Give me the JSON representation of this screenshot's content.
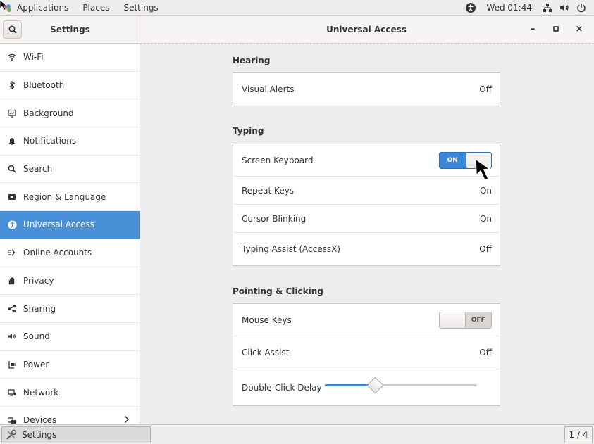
{
  "top_panel": {
    "menus": [
      "Applications",
      "Places",
      "Settings"
    ],
    "clock": "Wed 01:44",
    "icons": [
      "accessibility-icon",
      "network-icon",
      "volume-icon",
      "power-icon"
    ]
  },
  "window": {
    "sidebar_title": "Settings",
    "title": "Universal Access",
    "controls": {
      "minimize": "–",
      "maximize": "▫",
      "close": "×"
    }
  },
  "sidebar": {
    "items": [
      {
        "label": "Wi-Fi",
        "icon": "wifi-icon"
      },
      {
        "label": "Bluetooth",
        "icon": "bluetooth-icon"
      },
      {
        "label": "Background",
        "icon": "background-icon"
      },
      {
        "label": "Notifications",
        "icon": "bell-icon"
      },
      {
        "label": "Search",
        "icon": "search-icon"
      },
      {
        "label": "Region & Language",
        "icon": "region-icon"
      },
      {
        "label": "Universal Access",
        "icon": "accessibility-icon",
        "active": true
      },
      {
        "label": "Online Accounts",
        "icon": "online-accounts-icon"
      },
      {
        "label": "Privacy",
        "icon": "hand-icon"
      },
      {
        "label": "Sharing",
        "icon": "share-icon"
      },
      {
        "label": "Sound",
        "icon": "speaker-icon"
      },
      {
        "label": "Power",
        "icon": "power-plug-icon"
      },
      {
        "label": "Network",
        "icon": "network-icon"
      },
      {
        "label": "Devices",
        "icon": "devices-icon"
      }
    ]
  },
  "sections": {
    "hearing": {
      "title": "Hearing",
      "rows": [
        {
          "label": "Visual Alerts",
          "value": "Off"
        }
      ]
    },
    "typing": {
      "title": "Typing",
      "rows": [
        {
          "label": "Screen Keyboard",
          "switch": "ON"
        },
        {
          "label": "Repeat Keys",
          "value": "On"
        },
        {
          "label": "Cursor Blinking",
          "value": "On"
        },
        {
          "label": "Typing Assist (AccessX)",
          "value": "Off"
        }
      ]
    },
    "pointing": {
      "title": "Pointing & Clicking",
      "rows": [
        {
          "label": "Mouse Keys",
          "switch": "OFF"
        },
        {
          "label": "Click Assist",
          "value": "Off"
        },
        {
          "label": "Double-Click Delay",
          "slider_value": 0.33
        }
      ]
    }
  },
  "taskbar": {
    "item_label": "Settings",
    "pager": "1 / 4"
  },
  "colors": {
    "accent": "#4a90d9",
    "switch_on": "#3b86d8"
  }
}
